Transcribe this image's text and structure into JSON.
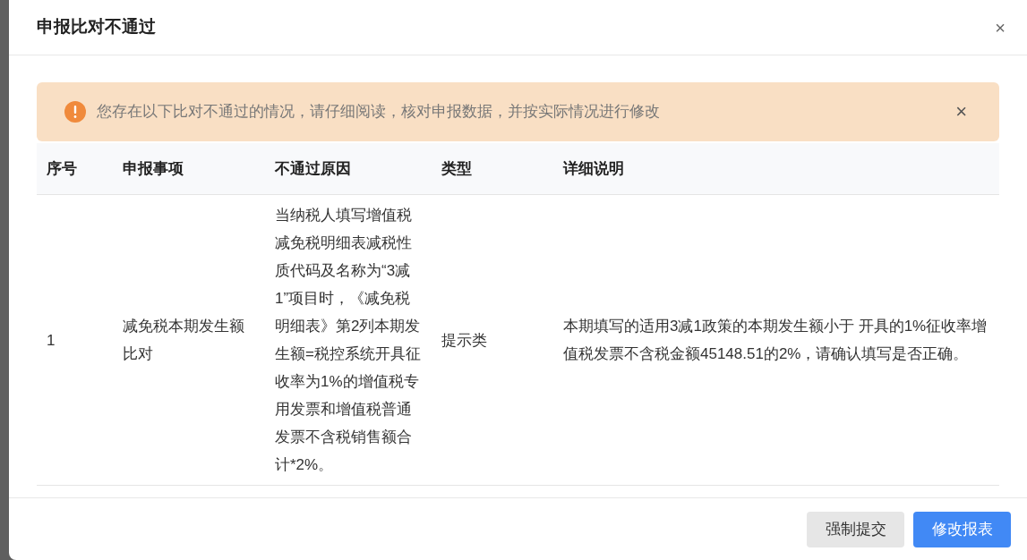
{
  "dialog": {
    "title": "申报比对不通过",
    "close_label": "×"
  },
  "alert": {
    "message": "您存在以下比对不通过的情况，请仔细阅读，核对申报数据，并按实际情况进行修改",
    "close_label": "×"
  },
  "table": {
    "columns": [
      "序号",
      "申报事项",
      "不通过原因",
      "类型",
      "详细说明"
    ],
    "rows": [
      {
        "cells": [
          "1",
          "减免税本期发生额比对",
          "当纳税人填写增值税减免税明细表减税性质代码及名称为“3减1”项目时，《减免税明细表》第2列本期发生额=税控系统开具征收率为1%的增值税专用发票和增值税普通发票不含税销售额合计*2%。",
          "提示类",
          "本期填写的适用3减1政策的本期发生额小于 开具的1%征收率增值税发票不含税金额45148.51的2%，请确认填写是否正确。"
        ]
      }
    ]
  },
  "buttons": [
    {
      "label": "强制提交",
      "kind": "secondary"
    },
    {
      "label": "修改报表",
      "kind": "primary"
    }
  ]
}
